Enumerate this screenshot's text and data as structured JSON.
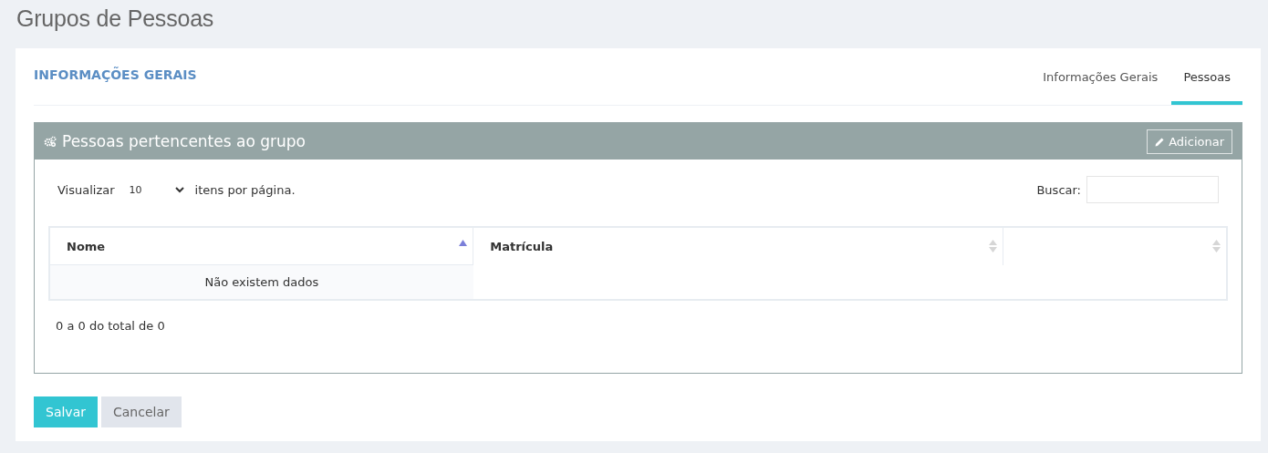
{
  "page_title": "Grupos de Pessoas",
  "section_title": "INFORMAÇÕES GERAIS",
  "tabs": [
    {
      "label": "Informações Gerais",
      "selected": false
    },
    {
      "label": "Pessoas",
      "selected": true
    }
  ],
  "portlet": {
    "title": "Pessoas pertencentes ao grupo",
    "add_button": "Adicionar",
    "page_size": {
      "before": "Visualizar",
      "value": "10",
      "after": "itens por página."
    },
    "search": {
      "label": "Buscar:"
    },
    "columns": [
      {
        "label": "Nome",
        "sorted_ascending": true
      },
      {
        "label": "Matrícula",
        "sorted_ascending": false
      },
      {
        "sorted_ascending": false
      }
    ],
    "empty_message": "Não existem dados",
    "info": "0 a 0 do total de 0"
  },
  "buttons": [
    {
      "label": "Salvar",
      "kind": "primary"
    },
    {
      "label": "Cancelar",
      "kind": "default"
    }
  ]
}
